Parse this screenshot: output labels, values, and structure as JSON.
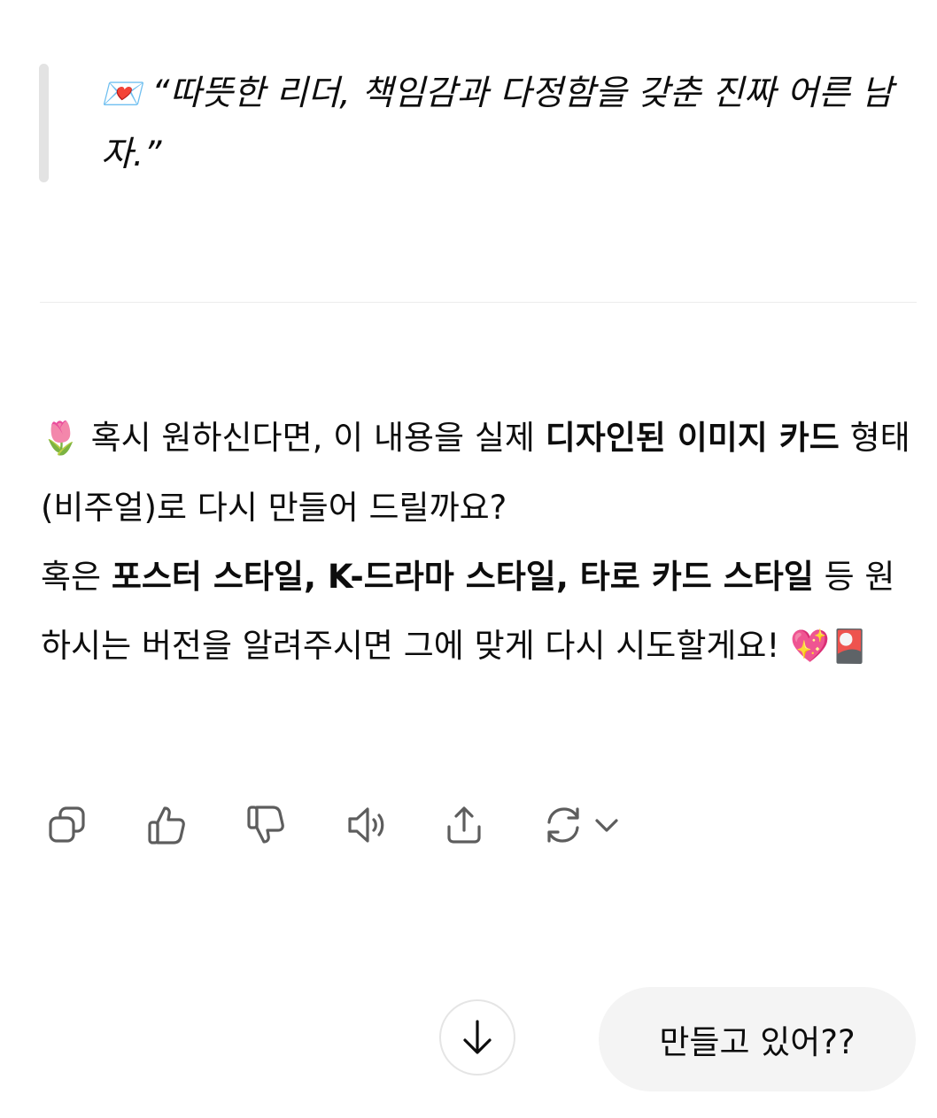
{
  "quote": {
    "emoji": "💌",
    "text": "“따뜻한 리더, 책임감과 다정함을 갖춘 진짜 어른 남자.”"
  },
  "message": {
    "line1_emoji": "🌷",
    "line1_text": " 혹시 원하신다면, 이 내용을 실제 ",
    "line1_bold": "디자인된 이미지 카드",
    "line1_tail": " 형태(비주얼)로 다시 만들어 드릴까요?",
    "line2_prefix": "혹은 ",
    "line2_bold": "포스터 스타일, K-드라마 스타일, 타로 카드 스타일",
    "line2_tail": " 등 원하시는 버전을 알려주시면 그에 맞게 다시 시도할게요! ",
    "line2_emoji_1": "💖",
    "line2_emoji_2": "🎴"
  },
  "actions": {
    "icons": [
      "copy-icon",
      "thumbs-up-icon",
      "thumbs-down-icon",
      "speaker-icon",
      "share-icon",
      "regenerate-icon",
      "chevron-down-icon"
    ]
  },
  "composer": {
    "scroll_icon": "arrow-down-icon",
    "user_message": "만들고 있어??"
  }
}
